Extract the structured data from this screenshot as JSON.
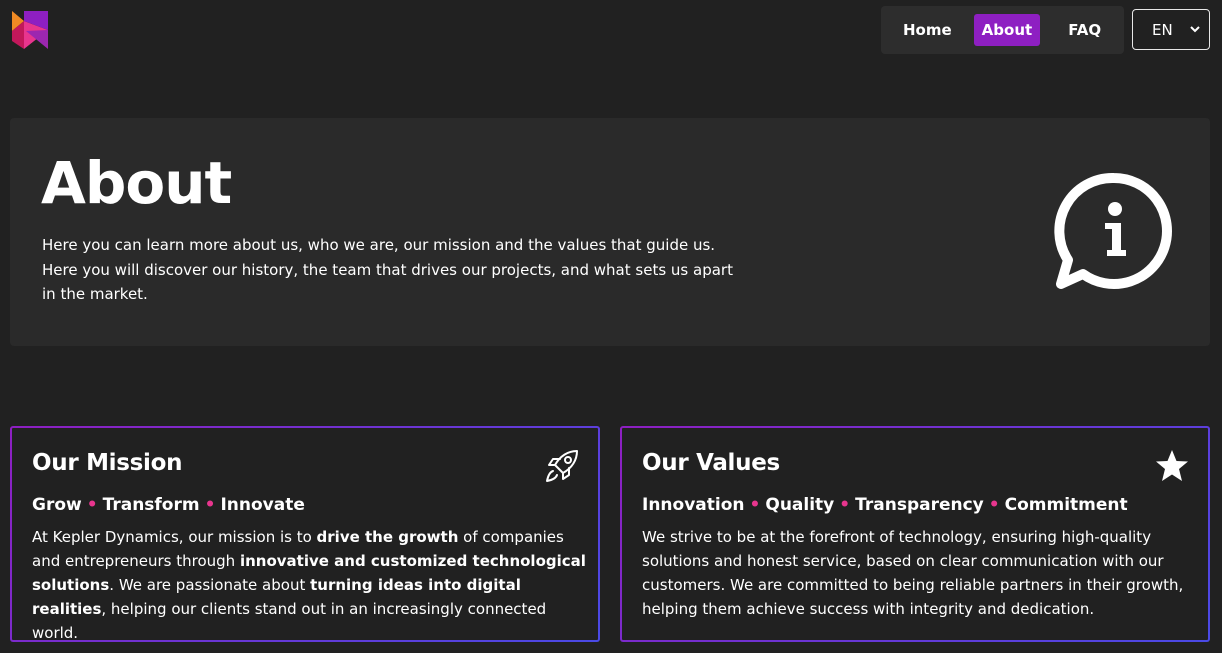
{
  "colors": {
    "background": "#212121",
    "surface": "#2a2a2a",
    "nav_bg": "#2d2d2d",
    "accent_purple": "#8e1fc2",
    "accent_pink": "#e8358e",
    "accent_blue": "#4a4ae6",
    "text": "#ffffff"
  },
  "header": {
    "logo_icon": "kepler-logo-icon",
    "nav": [
      {
        "label": "Home",
        "active": false
      },
      {
        "label": "About",
        "active": true
      },
      {
        "label": "FAQ",
        "active": false
      }
    ],
    "language": {
      "selected": "EN",
      "icon": "chevron-down-icon"
    }
  },
  "hero": {
    "title": "About",
    "description": "Here you can learn more about us, who we are, our mission and the values that guide us. Here you will discover our history, the team that drives our projects, and what sets us apart in the market.",
    "icon": "info-chat-bubble-icon"
  },
  "mission": {
    "title": "Our Mission",
    "icon": "rocket-icon",
    "tagline": [
      "Grow",
      "Transform",
      "Innovate"
    ],
    "separator": "•",
    "text": [
      {
        "t": "At Kepler Dynamics, our mission is to ",
        "b": false
      },
      {
        "t": "drive the growth",
        "b": true
      },
      {
        "t": " of companies and entrepreneurs through ",
        "b": false
      },
      {
        "t": "innovative and customized technological solutions",
        "b": true
      },
      {
        "t": ". We are passionate about ",
        "b": false
      },
      {
        "t": "turning ideas into digital realities",
        "b": true
      },
      {
        "t": ", helping our clients stand out in an increasingly connected world.",
        "b": false
      }
    ]
  },
  "values": {
    "title": "Our Values",
    "icon": "star-icon",
    "tagline": [
      "Innovation",
      "Quality",
      "Transparency",
      "Commitment"
    ],
    "separator": "•",
    "text": [
      {
        "t": "We strive to be at the forefront of technology, ensuring high-quality solutions and honest service, based on clear communication with our customers. We are committed to being reliable partners in their growth, helping them achieve success with integrity and dedication.",
        "b": false
      }
    ]
  }
}
